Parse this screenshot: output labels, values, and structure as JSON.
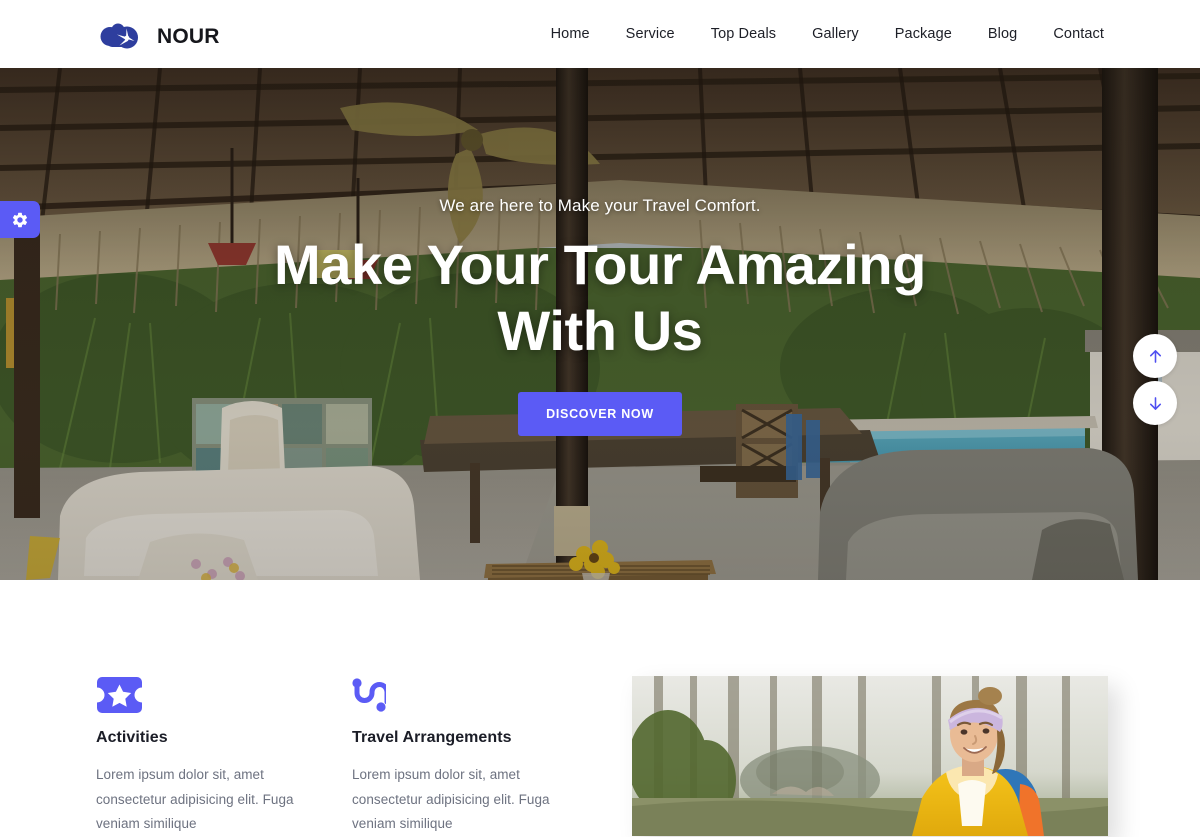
{
  "header": {
    "brand_name": "NOUR",
    "logo_icon": "cloud-plane-logo",
    "nav": [
      {
        "label": "Home"
      },
      {
        "label": "Service"
      },
      {
        "label": "Top Deals"
      },
      {
        "label": "Gallery"
      },
      {
        "label": "Package"
      },
      {
        "label": "Blog"
      },
      {
        "label": "Contact"
      }
    ]
  },
  "hero": {
    "kicker": "We are here to Make your Travel Comfort.",
    "title_line1": "Make Your Tour Amazing",
    "title_line2": "With Us",
    "cta_label": "DISCOVER NOW",
    "background_alt": "tropical thatched-roof pavilion with lounge seating and swimming pool"
  },
  "widgets": {
    "settings_tab_icon": "gear-icon",
    "cart_tab_icon": "cart-icon",
    "scroll_up_icon": "arrow-up-icon",
    "scroll_down_icon": "arrow-down-icon"
  },
  "features": [
    {
      "icon": "ticket-star-icon",
      "title": "Activities",
      "text": "Lorem ipsum dolor sit, amet consectetur adipisicing elit. Fuga veniam similique"
    },
    {
      "icon": "route-path-icon",
      "title": "Travel Arrangements",
      "text": "Lorem ipsum dolor sit, amet consectetur adipisicing elit. Fuga veniam similique"
    }
  ],
  "feature_image": {
    "alt": "smiling woman hiker in yellow jacket and lavender headband in a forest"
  },
  "colors": {
    "accent": "#5B5BF5",
    "logo_blue": "#2E3E9E",
    "heading": "#1b1d27",
    "body_text": "#6d7280",
    "nav_text": "#1d1f27",
    "white": "#ffffff"
  }
}
